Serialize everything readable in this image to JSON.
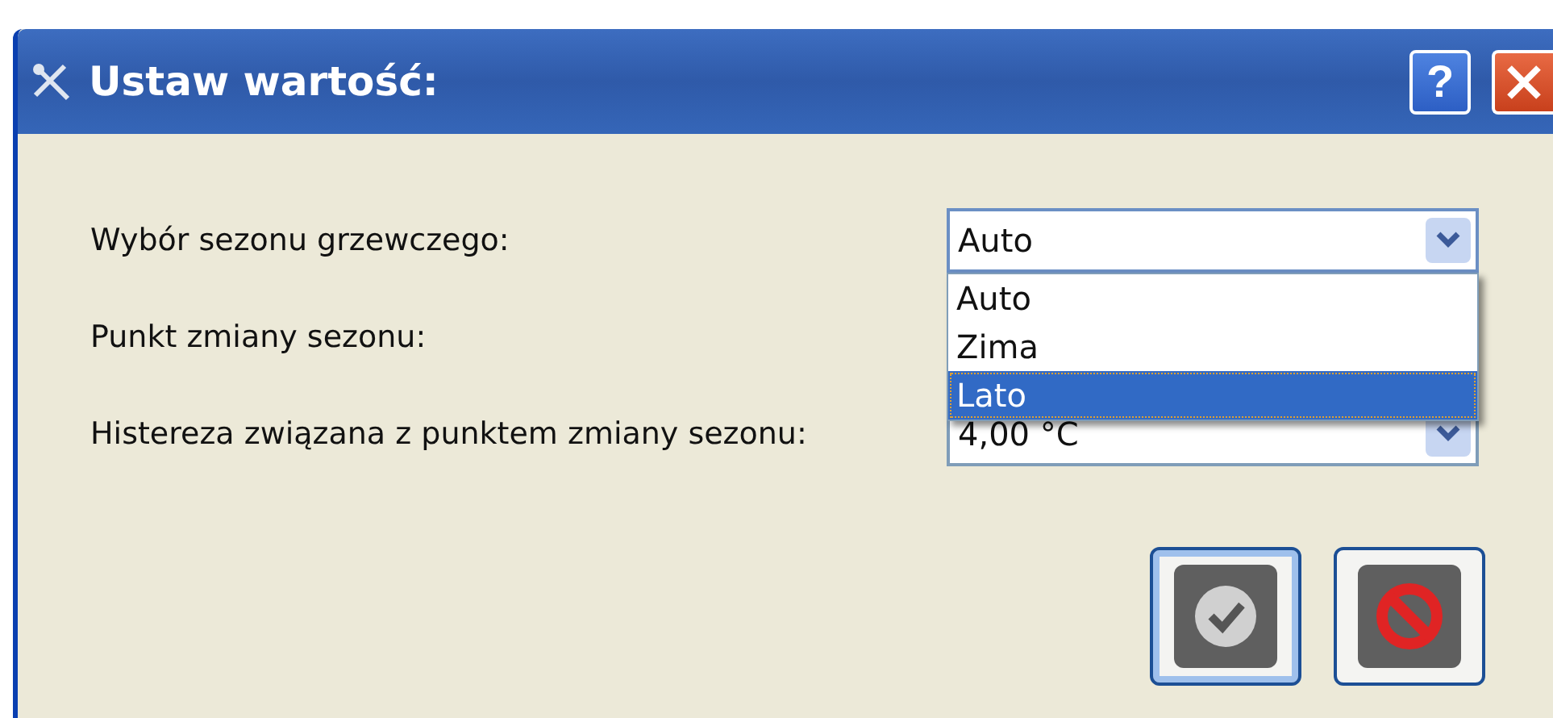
{
  "window": {
    "title": "Ustaw wartość:",
    "help_button": "?"
  },
  "fields": [
    {
      "label": "Wybór sezonu grzewczego:",
      "value": "Auto",
      "open": true,
      "options": [
        {
          "label": "Auto",
          "highlighted": false
        },
        {
          "label": "Zima",
          "highlighted": false
        },
        {
          "label": "Lato",
          "highlighted": true
        }
      ]
    },
    {
      "label": "Punkt zmiany sezonu:"
    },
    {
      "label": "Histereza związana z punktem zmiany sezonu:",
      "value": "4,00 °C",
      "open": false
    }
  ],
  "buttons": [
    {
      "kind": "confirm",
      "focused": true
    },
    {
      "kind": "cancel",
      "focused": false
    }
  ]
}
